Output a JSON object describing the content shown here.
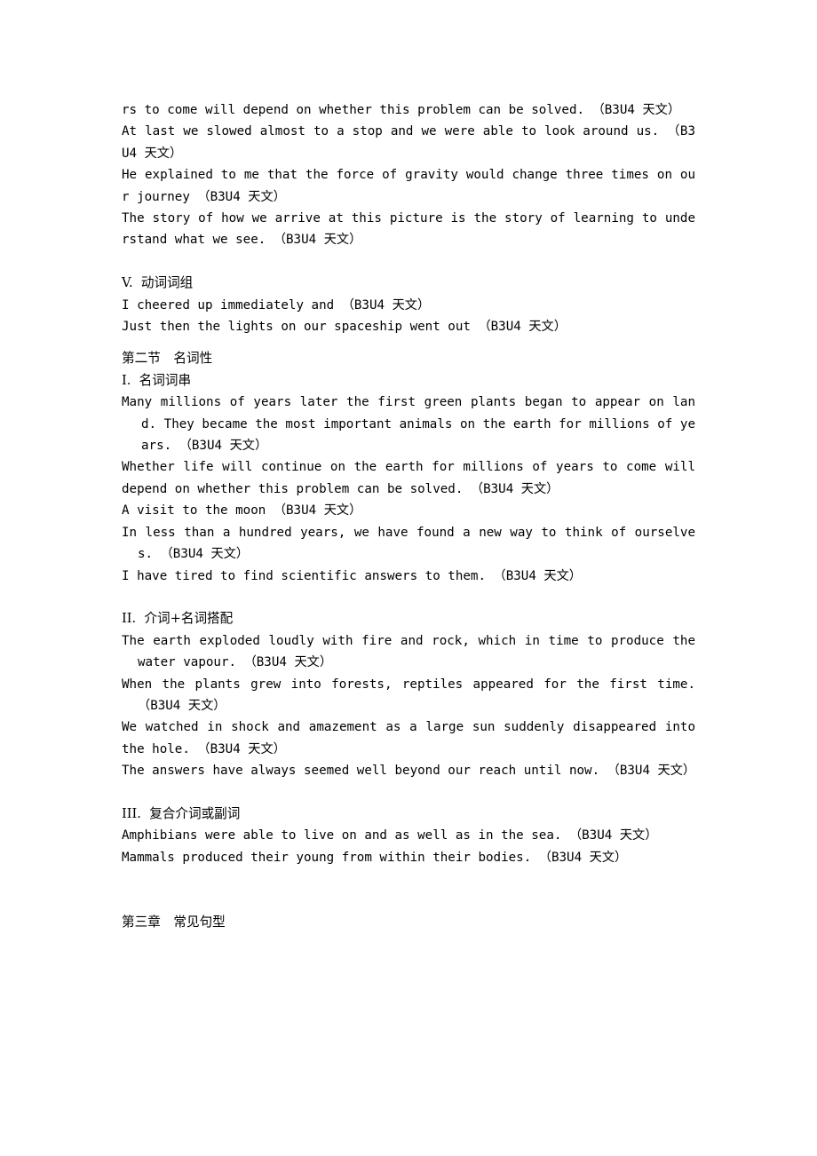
{
  "document": {
    "page_background": "#ffffff",
    "text_color": "#000000",
    "annotation_tag": "（B3U4 天文）"
  },
  "blocks": [
    {
      "id": "b1",
      "type": "sentence",
      "style": "plain",
      "text": "rs to come will depend on whether this problem can be solved. （B3U4 天文）"
    },
    {
      "id": "b2",
      "type": "sentence",
      "style": "plain",
      "text": "At last we slowed almost to a stop and we were able to look around us. （B3U4 天文）"
    },
    {
      "id": "b3",
      "type": "sentence",
      "style": "plain",
      "text": "He explained to me that the force of gravity would change three times on our journey （B3U4 天文）"
    },
    {
      "id": "b4",
      "type": "sentence",
      "style": "plain",
      "text": "The story of how we arrive at this picture is the story of learning to understand what we see. （B3U4 天文）"
    },
    {
      "id": "gap1",
      "type": "blank"
    },
    {
      "id": "h_v",
      "type": "heading-roman",
      "text": "V.  动词词组"
    },
    {
      "id": "b5",
      "type": "sentence",
      "style": "plain",
      "text": "I cheered up immediately and （B3U4 天文）"
    },
    {
      "id": "b6",
      "type": "sentence",
      "style": "plain",
      "text": "Just then the lights on our spaceship went out （B3U4 天文）"
    },
    {
      "id": "gap2",
      "type": "blank-half"
    },
    {
      "id": "h_section2",
      "type": "heading-cn",
      "text": "第二节　名词性"
    },
    {
      "id": "h_i",
      "type": "heading-roman",
      "text": "I.  名词词串"
    },
    {
      "id": "b7",
      "type": "sentence",
      "style": "hang2",
      "text": "Many millions of years later the first green plants began to appear on land. They became the most important animals on the earth for millions of years. （B3U4 天文）"
    },
    {
      "id": "b8",
      "type": "sentence",
      "style": "plain",
      "text": "Whether life will continue on the earth for millions of years to come will depend on whether this problem can be solved. （B3U4 天文）"
    },
    {
      "id": "b9",
      "type": "sentence",
      "style": "plain",
      "text": "A visit to the moon （B3U4 天文）"
    },
    {
      "id": "b10",
      "type": "sentence",
      "style": "hang",
      "text": "In less than a hundred years, we have found a new way to think of ourselves. （B3U4 天文）"
    },
    {
      "id": "b11",
      "type": "sentence",
      "style": "plain",
      "text": "I have tired to find scientific answers to them. （B3U4 天文）"
    },
    {
      "id": "gap3",
      "type": "blank"
    },
    {
      "id": "h_ii",
      "type": "heading-roman",
      "text": "II.  介词+名词搭配"
    },
    {
      "id": "b12",
      "type": "sentence",
      "style": "hang",
      "text": "The earth exploded loudly with fire and rock, which in time to produce the water vapour. （B3U4 天文）"
    },
    {
      "id": "b13",
      "type": "sentence",
      "style": "hang",
      "text": "When the plants grew into forests, reptiles appeared for the first time. （B3U4 天文）"
    },
    {
      "id": "b14",
      "type": "sentence",
      "style": "plain",
      "text": "We watched in shock and amazement as a large sun suddenly disappeared into the hole. （B3U4 天文）"
    },
    {
      "id": "b15",
      "type": "sentence",
      "style": "plain",
      "text": "The answers have always seemed well beyond our reach until now. （B3U4 天文）"
    },
    {
      "id": "gap4",
      "type": "blank"
    },
    {
      "id": "h_iii",
      "type": "heading-roman",
      "text": "III.  复合介词或副词"
    },
    {
      "id": "b16",
      "type": "sentence",
      "style": "hang",
      "text": "Amphibians were able to live on and as well as in the sea. （B3U4 天文）"
    },
    {
      "id": "b17",
      "type": "sentence",
      "style": "plain",
      "text": "Mammals produced their young from within their bodies. （B3U4 天文）"
    },
    {
      "id": "gap5",
      "type": "blank-big"
    },
    {
      "id": "h_chapter3",
      "type": "chapter",
      "text": "第三章　常见句型"
    }
  ]
}
